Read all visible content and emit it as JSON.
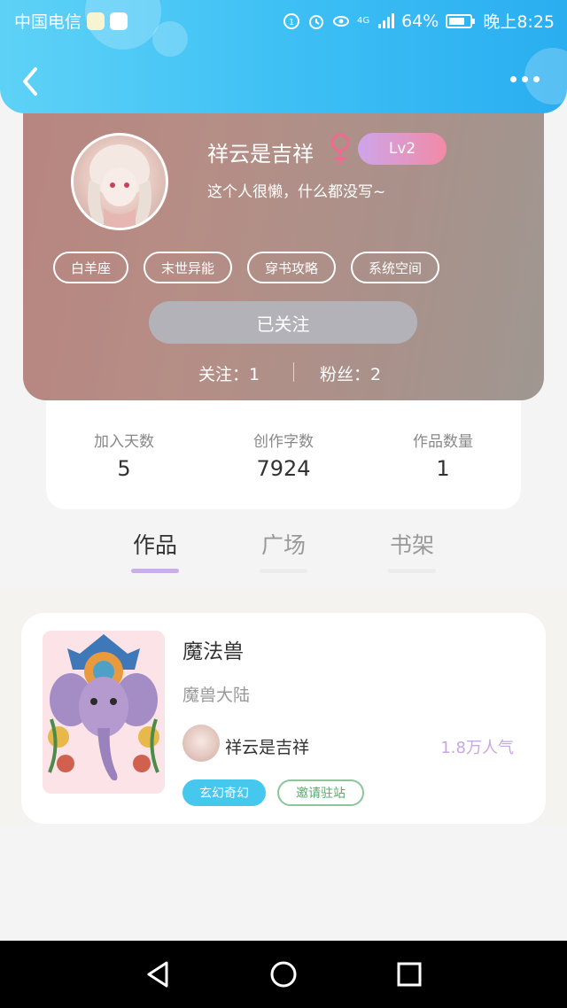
{
  "status_bar": {
    "carrier": "中国电信",
    "network": "4G",
    "battery": "64%",
    "time": "晚上8:25"
  },
  "profile": {
    "username": "祥云是吉祥",
    "gender_symbol": "♀",
    "level": "Lv2",
    "bio": "这个人很懒，什么都没写~",
    "tags": [
      "白羊座",
      "末世异能",
      "穿书攻略",
      "系统空间"
    ],
    "follow_button": "已关注",
    "following": "关注：1",
    "followers": "粉丝：2"
  },
  "stats": [
    {
      "label": "加入天数",
      "value": "5"
    },
    {
      "label": "创作字数",
      "value": "7924"
    },
    {
      "label": "作品数量",
      "value": "1"
    }
  ],
  "tabs": [
    {
      "label": "作品",
      "active": true
    },
    {
      "label": "广场",
      "active": false
    },
    {
      "label": "书架",
      "active": false
    }
  ],
  "work": {
    "title": "魔法兽",
    "subtitle": "魔兽大陆",
    "author": "祥云是吉祥",
    "popularity": "1.8万人气",
    "genre_tag": "玄幻奇幻",
    "invite_tag": "邀请驻站"
  },
  "colors": {
    "header": "#3ec0f5",
    "level_badge": "#e99ac0",
    "accent_purple": "#c8a6e4",
    "genre_tag": "#45c7ee",
    "invite_tag": "#8bc59a"
  },
  "icons": [
    "back-icon",
    "more-icon",
    "female-icon",
    "nav-back-icon",
    "nav-home-icon",
    "nav-recents-icon"
  ]
}
